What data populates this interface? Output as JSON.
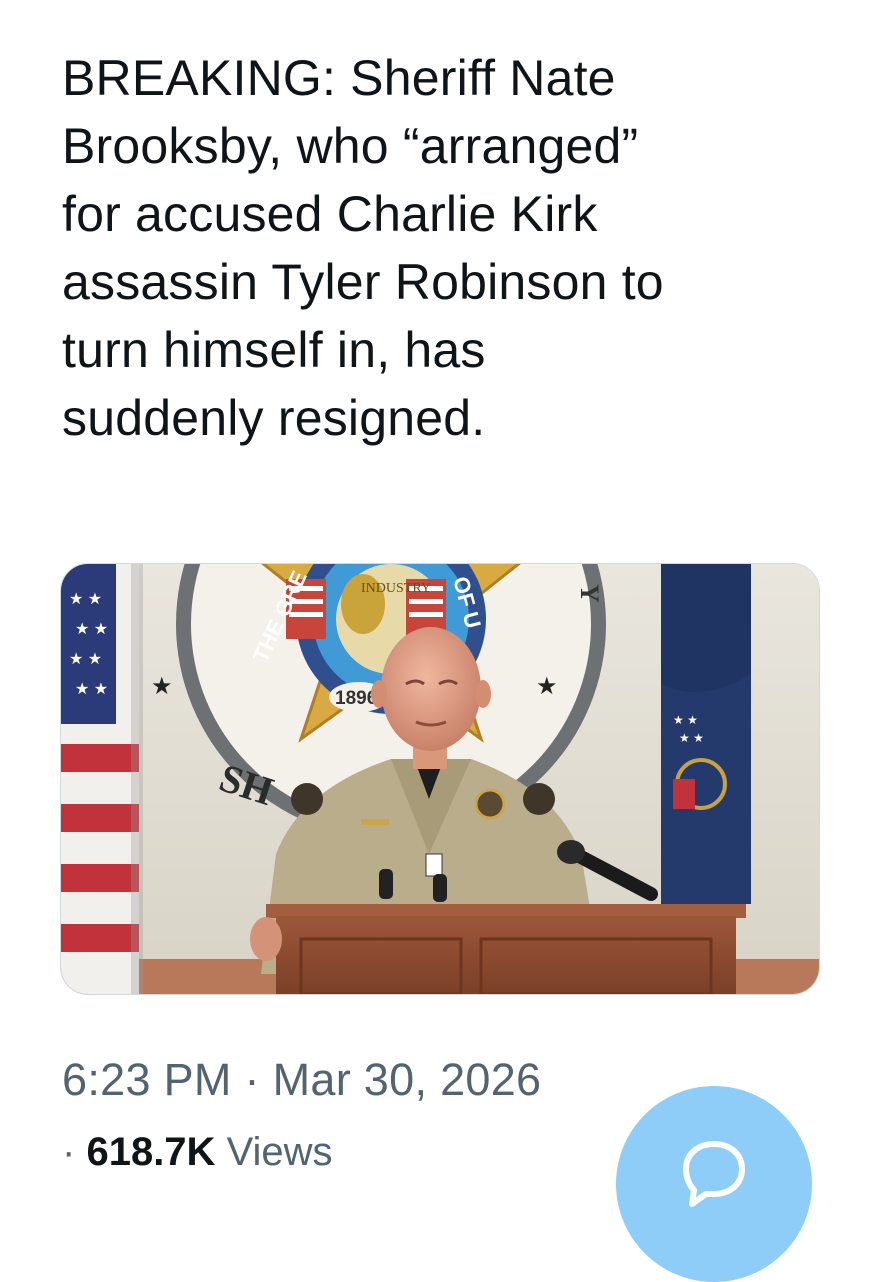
{
  "post": {
    "text": "BREAKING: Sheriff Nate\nBrooksby, who “arranged”\nfor accused Charlie Kirk\nassassin Tyler Robinson to\nturn himself in, has\nsuddenly resigned.",
    "time": "6:23 PM",
    "separator": "·",
    "date": "Mar 30, 2026",
    "views_dot": "·",
    "views_count": "618.7K",
    "views_label": "Views"
  },
  "media": {
    "seal_year": "1896",
    "seal_arc_left": "THE GRE",
    "seal_arc_right": "OF U",
    "seal_top": "INDUSTRY",
    "seal_bottom_text": "SH"
  },
  "compose_button": {
    "icon": "compose-icon"
  },
  "colors": {
    "text_primary": "#0f1419",
    "text_secondary": "#536471",
    "fab": "#8ecdf8",
    "uniform": "#b9ad8c",
    "podium": "#8f4e34"
  }
}
